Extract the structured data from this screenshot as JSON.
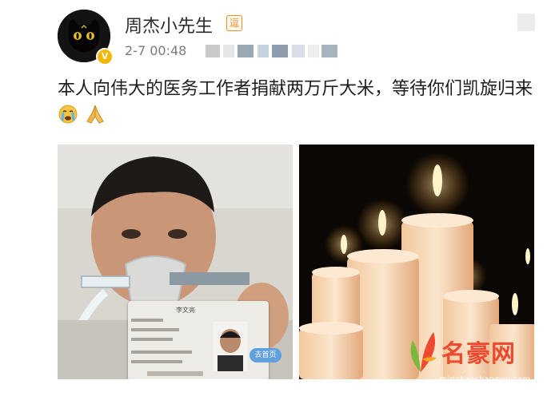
{
  "post": {
    "username": "周杰小先生",
    "vip_badge": "逗",
    "verified_mark": "V",
    "timestamp": "2-7 00:48",
    "text": "本人向伟大的医务工作者捐献两万斤大米，等待你们凯旋归来",
    "emojis": [
      "crying-face-icon",
      "praying-hands-icon"
    ]
  },
  "images": {
    "left": {
      "subject": "hospital-selfie-with-id-card",
      "id_tag": "去首页",
      "card_name": "李文亮"
    },
    "right": {
      "subject": "lit-candles"
    }
  },
  "watermark": {
    "name": "名豪网",
    "url": "minghaoshangwu.com"
  },
  "colors": {
    "username": "#2b2b2b",
    "meta": "#7a7a7a",
    "vip": "#f28e2b",
    "watermark": "#ef4a30"
  }
}
